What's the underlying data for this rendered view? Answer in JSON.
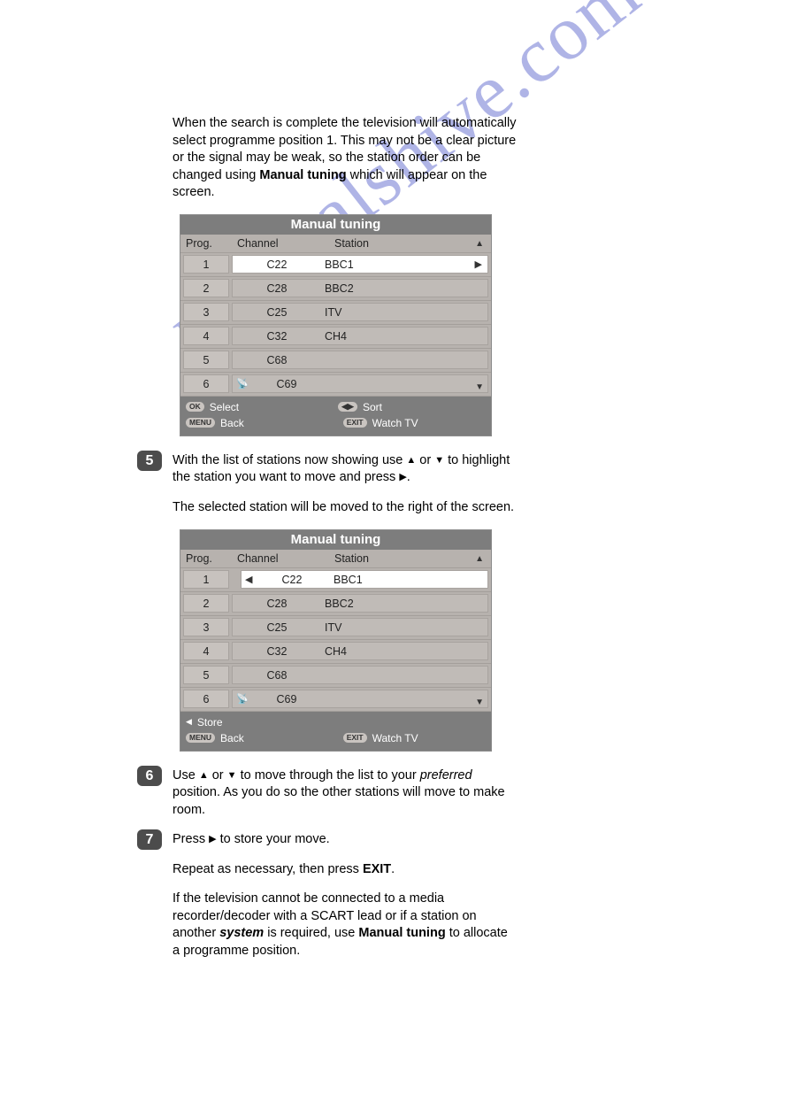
{
  "watermark": "manualshive.com",
  "intro": {
    "p1a": "When the search is complete the television will automatically select programme position 1. This may not be a clear picture or the signal may be weak, so the station order can be changed using ",
    "p1b": "Manual tuning",
    "p1c": " which will appear on the screen."
  },
  "osd1": {
    "title": "Manual tuning",
    "head": {
      "prog": "Prog.",
      "channel": "Channel",
      "station": "Station"
    },
    "rows": [
      {
        "prog": "1",
        "channel": "C22",
        "station": "BBC1",
        "selected": true,
        "arrowRight": true
      },
      {
        "prog": "2",
        "channel": "C28",
        "station": "BBC2"
      },
      {
        "prog": "3",
        "channel": "C25",
        "station": "ITV"
      },
      {
        "prog": "4",
        "channel": "C32",
        "station": "CH4"
      },
      {
        "prog": "5",
        "channel": "C68",
        "station": ""
      },
      {
        "prog": "6",
        "channel": "C69",
        "station": "",
        "sat": true
      }
    ],
    "foot": {
      "ok": "OK",
      "select": "Select",
      "sort": "Sort",
      "menu": "MENU",
      "back": "Back",
      "exit": "EXIT",
      "watch": "Watch TV"
    }
  },
  "step5": {
    "num": "5",
    "p1a": "With the list of stations now showing use ",
    "p1b": " or ",
    "p1c": " to highlight the station you want to move and press ",
    "p1d": ".",
    "p2": "The selected station will be moved to the right of the screen."
  },
  "osd2": {
    "title": "Manual tuning",
    "head": {
      "prog": "Prog.",
      "channel": "Channel",
      "station": "Station"
    },
    "rows": [
      {
        "prog": "1",
        "channel": "C22",
        "station": "BBC1",
        "selected": true,
        "arrowLeft": true,
        "shift": true
      },
      {
        "prog": "2",
        "channel": "C28",
        "station": "BBC2"
      },
      {
        "prog": "3",
        "channel": "C25",
        "station": "ITV"
      },
      {
        "prog": "4",
        "channel": "C32",
        "station": "CH4"
      },
      {
        "prog": "5",
        "channel": "C68",
        "station": ""
      },
      {
        "prog": "6",
        "channel": "C69",
        "station": "",
        "sat": true
      }
    ],
    "foot": {
      "store": "Store",
      "menu": "MENU",
      "back": "Back",
      "exit": "EXIT",
      "watch": "Watch TV"
    }
  },
  "step6": {
    "num": "6",
    "a": "Use ",
    "b": " or ",
    "c": " to move through the list to your ",
    "d": "preferred",
    "e": " position. As you do so the other stations will move to make room."
  },
  "step7": {
    "num": "7",
    "a": "Press ",
    "b": " to store your move.",
    "p2a": "Repeat as necessary, then press ",
    "p2b": "EXIT",
    "p2c": ".",
    "p3a": "If the television cannot be connected to a media recorder/decoder with a SCART lead or if a station on another ",
    "p3b": "system",
    "p3c": " is required, use ",
    "p3d": "Manual tuning",
    "p3e": " to allocate a programme position."
  }
}
